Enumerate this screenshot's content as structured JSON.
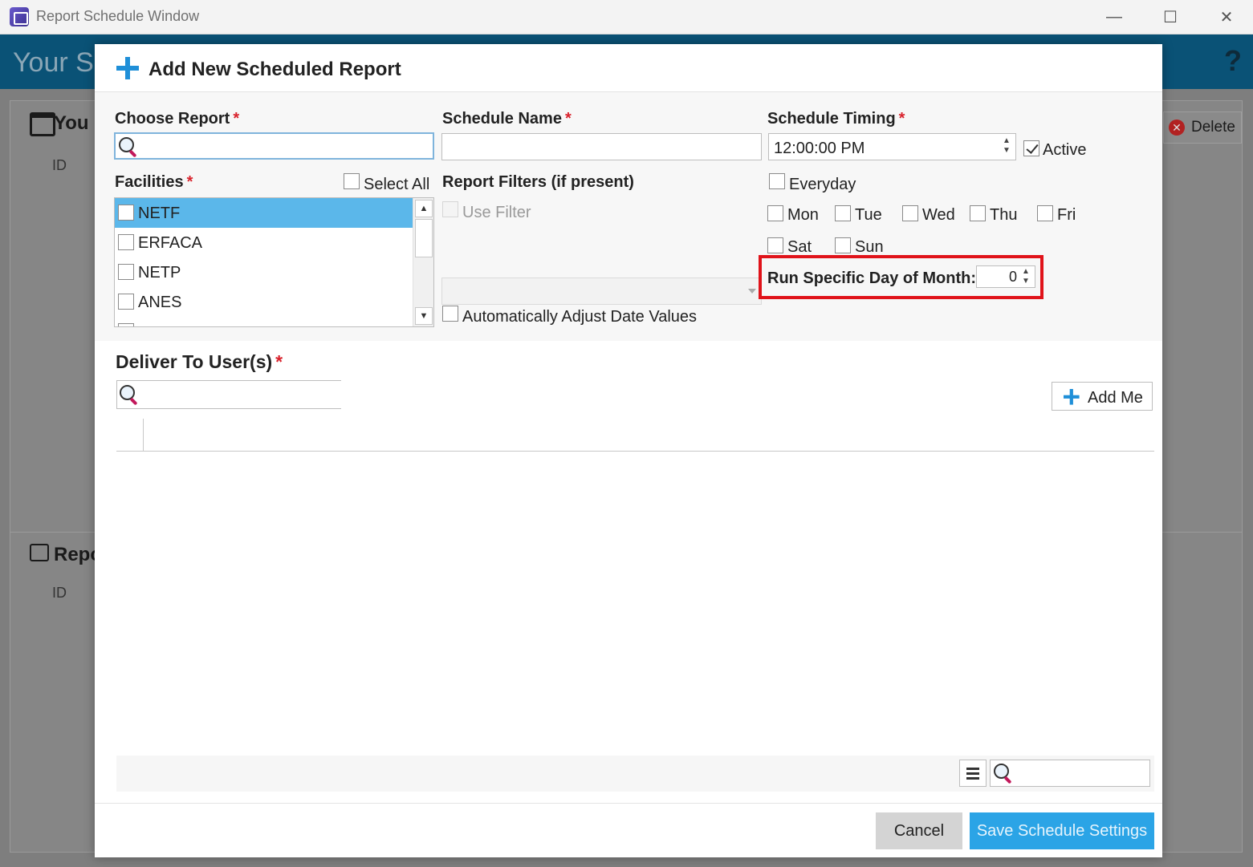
{
  "window": {
    "title": "Report Schedule Window",
    "controls": {
      "minimize": "—",
      "maximize": "☐",
      "close": "✕"
    }
  },
  "background": {
    "header_title": "Your Sc",
    "header_icons": "? ",
    "panel1_title": "You",
    "panel1_col": "ID",
    "delete_label": "Delete",
    "panel2_title": "Repo",
    "panel2_col": "ID"
  },
  "dialog": {
    "title": "Add New Scheduled Report",
    "choose_report": {
      "label": "Choose Report",
      "required": "*",
      "value": ""
    },
    "schedule_name": {
      "label": "Schedule Name",
      "required": "*",
      "value": ""
    },
    "schedule_timing": {
      "label": "Schedule Timing",
      "required": "*",
      "value": "12:00:00 PM"
    },
    "active": {
      "label": "Active",
      "checked": true
    },
    "facilities": {
      "label": "Facilities",
      "required": "*",
      "select_all_label": "Select All",
      "items": [
        {
          "label": "NETF",
          "selected": true
        },
        {
          "label": "ERFACA",
          "selected": false
        },
        {
          "label": "NETP",
          "selected": false
        },
        {
          "label": "ANES",
          "selected": false
        }
      ]
    },
    "report_filters": {
      "label": "Report Filters (if present)",
      "use_filter_label": "Use Filter",
      "auto_adjust_label": "Automatically Adjust Date Values"
    },
    "days": {
      "everyday": "Everyday",
      "mon": "Mon",
      "tue": "Tue",
      "wed": "Wed",
      "thu": "Thu",
      "fri": "Fri",
      "sat": "Sat",
      "sun": "Sun"
    },
    "specific_day": {
      "label": "Run Specific Day of Month:",
      "value": "0"
    },
    "deliver": {
      "label": "Deliver To User(s)",
      "required": "*",
      "add_me_label": "Add Me"
    },
    "footer": {
      "cancel_label": "Cancel",
      "save_label": "Save Schedule Settings"
    }
  },
  "colors": {
    "accent": "#2ba4e6",
    "selected_row": "#5bb7ea",
    "required": "#d9232d",
    "highlight": "#e0131a"
  }
}
